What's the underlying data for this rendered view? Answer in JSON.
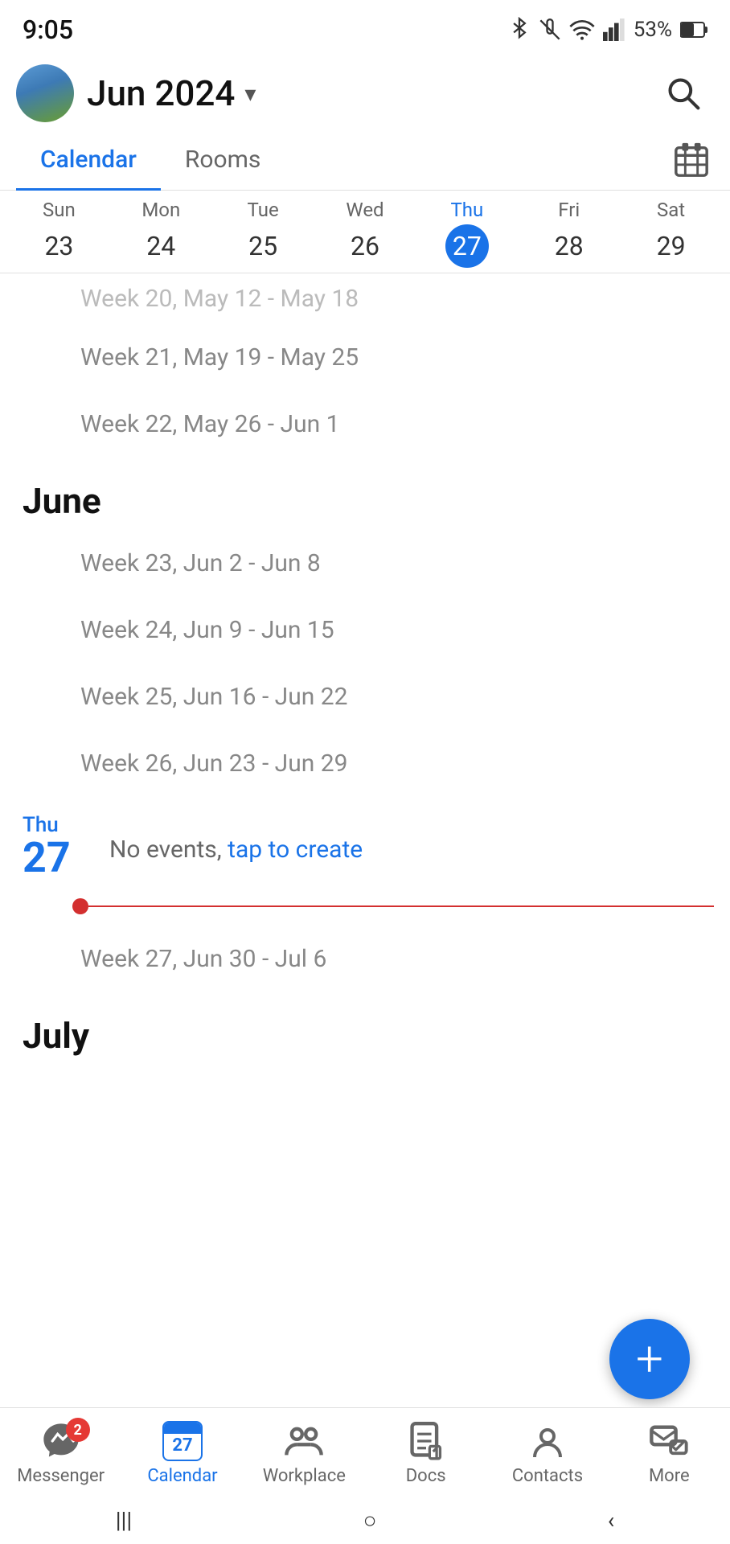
{
  "status": {
    "time": "9:05",
    "battery": "53%"
  },
  "header": {
    "title": "Jun 2024",
    "dropdown_icon": "▾"
  },
  "tabs": {
    "items": [
      {
        "label": "Calendar",
        "active": true
      },
      {
        "label": "Rooms",
        "active": false
      }
    ]
  },
  "day_headers": [
    {
      "name": "Sun",
      "num": "23",
      "today": false,
      "thu": false
    },
    {
      "name": "Mon",
      "num": "24",
      "today": false,
      "thu": false
    },
    {
      "name": "Tue",
      "num": "25",
      "today": false,
      "thu": false
    },
    {
      "name": "Wed",
      "num": "26",
      "today": false,
      "thu": false
    },
    {
      "name": "Thu",
      "num": "27",
      "today": true,
      "thu": true
    },
    {
      "name": "Fri",
      "num": "28",
      "today": false,
      "thu": false
    },
    {
      "name": "Sat",
      "num": "29",
      "today": false,
      "thu": false
    }
  ],
  "scroll": {
    "partial_week": "Week 20, May 12 - May 18",
    "weeks_may": [
      "Week 21, May 19 - May 25",
      "Week 22, May 26 - Jun 1"
    ],
    "month_june": "June",
    "weeks_june": [
      "Week 23, Jun 2 - Jun 8",
      "Week 24, Jun 9 - Jun 15",
      "Week 25, Jun 16 - Jun 22",
      "Week 26, Jun 23 - Jun 29"
    ],
    "today_day_name": "Thu",
    "today_day_num": "27",
    "no_events_text": "No events, ",
    "tap_to_create": "tap to create",
    "week_27": "Week 27, Jun 30 - Jul 6",
    "month_july": "July"
  },
  "fab": {
    "label": "+"
  },
  "bottom_nav": {
    "items": [
      {
        "label": "Messenger",
        "icon": "messenger",
        "active": false,
        "badge": "2"
      },
      {
        "label": "Calendar",
        "icon": "calendar",
        "active": true,
        "badge": null,
        "cal_num": "27"
      },
      {
        "label": "Workplace",
        "icon": "workplace",
        "active": false,
        "badge": null
      },
      {
        "label": "Docs",
        "icon": "docs",
        "active": false,
        "badge": null
      },
      {
        "label": "Contacts",
        "icon": "contacts",
        "active": false,
        "badge": null
      },
      {
        "label": "More",
        "icon": "more",
        "active": false,
        "badge": null
      }
    ]
  },
  "system_nav": {
    "back": "‹",
    "home": "○",
    "recent": "|||"
  }
}
